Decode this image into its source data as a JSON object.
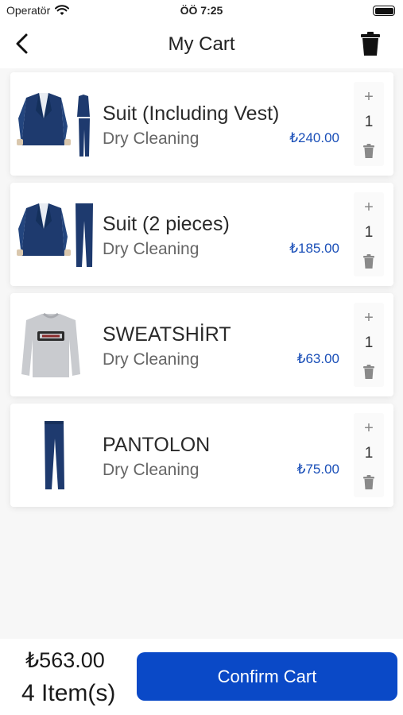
{
  "status_bar": {
    "carrier": "Operatör",
    "time": "ÖÖ 7:25"
  },
  "nav": {
    "title": "My Cart"
  },
  "colors": {
    "accent": "#0a49c7",
    "price": "#1a4fb8",
    "navy": "#1e3a6e"
  },
  "items": [
    {
      "name": "Suit (Including Vest)",
      "service": "Dry Cleaning",
      "price": "₺240.00",
      "quantity": "1",
      "plus": "+",
      "image": "suit-with-vest-icon"
    },
    {
      "name": "Suit (2 pieces)",
      "service": "Dry Cleaning",
      "price": "₺185.00",
      "quantity": "1",
      "plus": "+",
      "image": "two-piece-suit-icon"
    },
    {
      "name": "SWEATSHİRT",
      "service": "Dry Cleaning",
      "price": "₺63.00",
      "quantity": "1",
      "plus": "+",
      "image": "sweatshirt-icon"
    },
    {
      "name": "PANTOLON",
      "service": "Dry Cleaning",
      "price": "₺75.00",
      "quantity": "1",
      "plus": "+",
      "image": "trousers-icon"
    }
  ],
  "footer": {
    "total": "₺563.00",
    "item_count": "4 Item(s)",
    "confirm_label": "Confirm Cart"
  }
}
